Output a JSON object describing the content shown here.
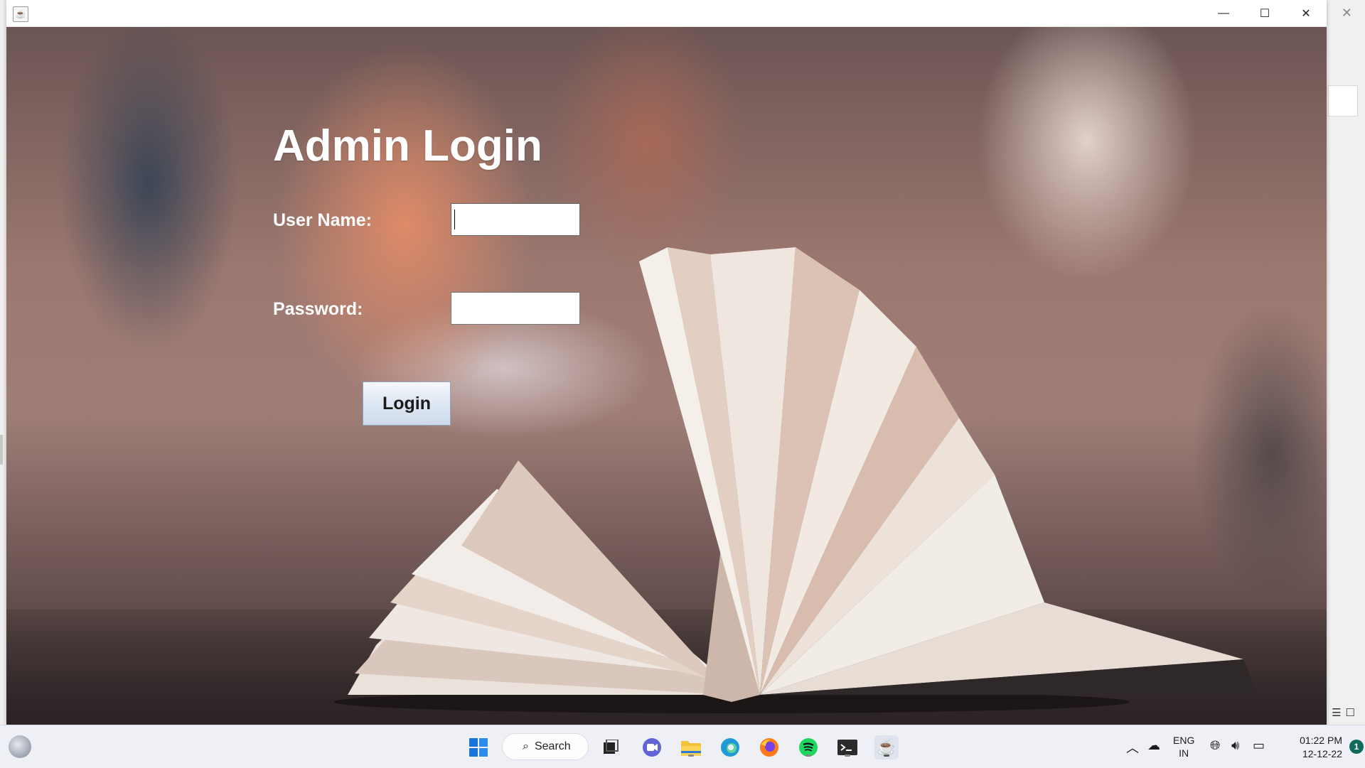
{
  "window": {
    "title": "",
    "controls": {
      "minimize": "—",
      "maximize": "☐",
      "close": "✕"
    }
  },
  "login": {
    "title": "Admin Login",
    "username_label": "User Name:",
    "username_value": "",
    "password_label": "Password:",
    "password_value": "",
    "button_label": "Login"
  },
  "taskbar": {
    "search_label": "Search",
    "apps": [
      "start",
      "search",
      "task-view",
      "chat",
      "file-explorer",
      "edge",
      "firefox",
      "spotify",
      "terminal",
      "java"
    ],
    "tray": {
      "lang_line1": "ENG",
      "lang_line2": "IN",
      "time": "01:22 PM",
      "date": "12-12-22",
      "notification_count": "1"
    }
  },
  "colors": {
    "title_text": "#ffffff",
    "button_gradient_top": "#f6f8fb",
    "button_gradient_bottom": "#cfdbeb",
    "taskbar_bg": "#eef0f6",
    "badge": "#0f6b5c"
  }
}
